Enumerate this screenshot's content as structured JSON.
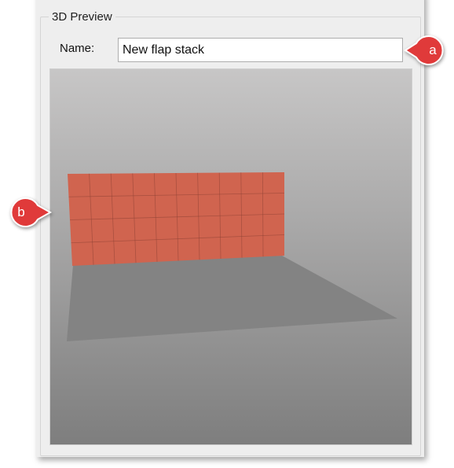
{
  "group": {
    "title": "3D Preview"
  },
  "name_field": {
    "label": "Name:",
    "value": "New flap stack"
  },
  "preview": {
    "grid_rows": 4,
    "grid_cols": 10,
    "panel_color": "#d0644f",
    "floor_color": "#838383",
    "bg_top": "#c7c6c6",
    "bg_bottom": "#7e7e7e"
  },
  "callouts": [
    {
      "label": "a",
      "color": "#e03a3a"
    },
    {
      "label": "b",
      "color": "#e03a3a"
    }
  ]
}
